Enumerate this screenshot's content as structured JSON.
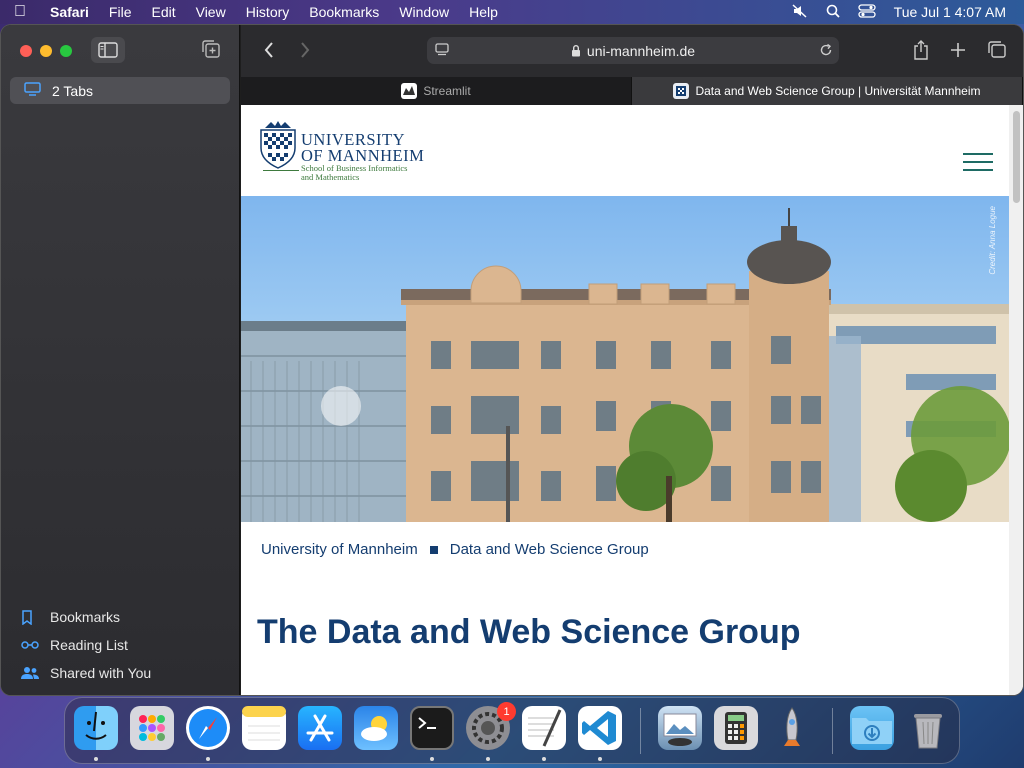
{
  "menubar": {
    "app": "Safari",
    "items": [
      "File",
      "Edit",
      "View",
      "History",
      "Bookmarks",
      "Window",
      "Help"
    ],
    "clock": "Tue Jul 1  4:07 AM"
  },
  "sidebar": {
    "tabs_label": "2 Tabs",
    "bottom": [
      {
        "label": "Bookmarks",
        "icon": "bookmark-icon"
      },
      {
        "label": "Reading List",
        "icon": "glasses-icon"
      },
      {
        "label": "Shared with You",
        "icon": "people-icon"
      }
    ]
  },
  "toolbar": {
    "url": "uni-mannheim.de"
  },
  "tabs": [
    {
      "title": "Streamlit",
      "active": false
    },
    {
      "title": "Data and Web Science Group | Universität Mannheim",
      "active": true
    }
  ],
  "page": {
    "logo": {
      "line1": "UNIVERSITY",
      "line2": "OF MANNHEIM",
      "line3": "School of Business Informatics",
      "line4": "and Mathematics"
    },
    "hero_credit": "Credit: Anna Logue",
    "breadcrumb": [
      "University of Mannheim",
      "Data and Web Science Group"
    ],
    "title": "The Data and Web Science Group"
  },
  "dock": {
    "apps": [
      "Finder",
      "Launchpad",
      "Safari",
      "Notes",
      "App Store",
      "Weather",
      "Terminal",
      "System Settings",
      "TextEdit",
      "Visual Studio Code",
      "Preview",
      "Calculator",
      "Rocket",
      "Downloads",
      "Trash"
    ],
    "system_settings_badge": "1"
  },
  "colors": {
    "brand": "#143d70",
    "accent_green": "#3e7a3e"
  }
}
